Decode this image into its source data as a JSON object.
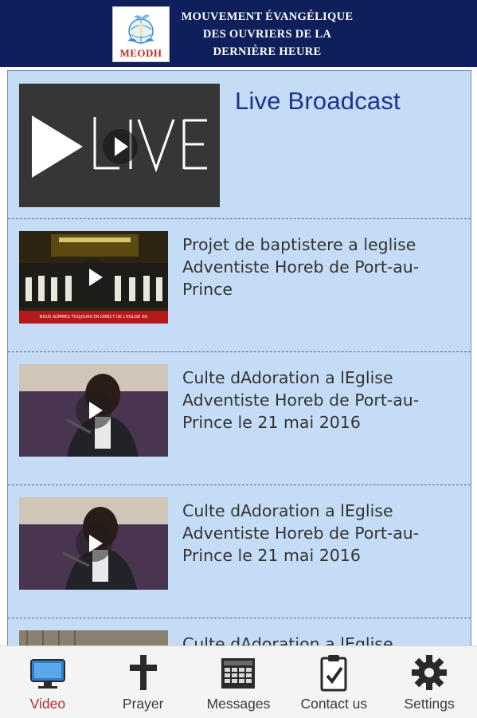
{
  "header": {
    "logo_text": "MEODH",
    "title_lines": [
      "MOUVEMENT ÉVANGÉLIQUE",
      "DES OUVRIERS DE LA",
      "DERNIÈRE HEURE"
    ]
  },
  "live": {
    "thumb_text": "LIVE",
    "title": "Live Broadcast"
  },
  "videos": [
    {
      "title": "Projet de baptistere a leglise Adventiste Horeb de Port-au-Prince",
      "caption": "NOUS SOMMES TOUJOURS EN DIRECT DE L'EGLISE AD"
    },
    {
      "title": "Culte dAdoration a lEglise Adventiste Horeb de Port-au-Prince le 21 mai 2016"
    },
    {
      "title": "Culte dAdoration a lEglise Adventiste Horeb de Port-au-Prince le 21 mai 2016"
    },
    {
      "title": "Culte dAdoration a lEglise"
    }
  ],
  "tabs": [
    {
      "label": "Video",
      "icon": "monitor-icon",
      "active": true
    },
    {
      "label": "Prayer",
      "icon": "cross-icon",
      "active": false
    },
    {
      "label": "Messages",
      "icon": "calendar-grid-icon",
      "active": false
    },
    {
      "label": "Contact us",
      "icon": "clipboard-check-icon",
      "active": false
    },
    {
      "label": "Settings",
      "icon": "gear-icon",
      "active": false
    }
  ],
  "colors": {
    "header_bg": "#0f1f5c",
    "list_bg": "#c5dcf6",
    "live_title": "#22308f",
    "active_tab": "#b82a2a",
    "monitor_blue": "#2f7fc6"
  }
}
